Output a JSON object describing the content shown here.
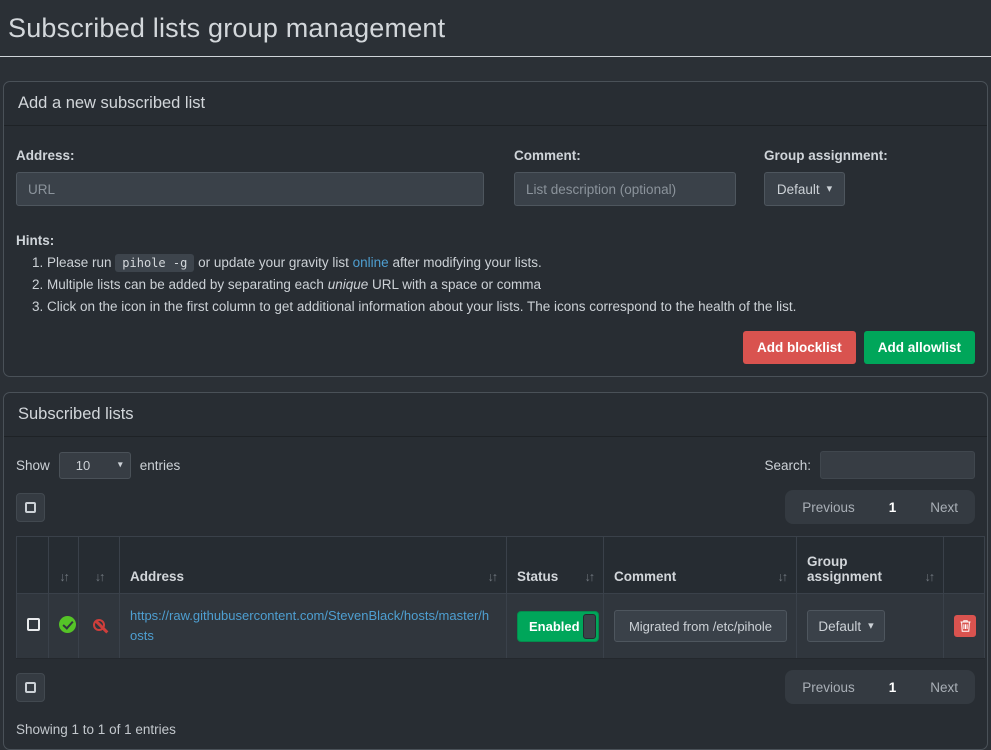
{
  "page_title": "Subscribed lists group management",
  "colors": {
    "accent_red": "#d9534f",
    "accent_green": "#00a65a",
    "link_blue": "#4e9fd1",
    "health_ok_green": "#55c327",
    "health_ban_red": "#ce3e3b"
  },
  "icons": {
    "sort": "↓↑",
    "caret_down": "▾"
  },
  "add_panel": {
    "title": "Add a new subscribed list",
    "address_label": "Address:",
    "address_placeholder": "URL",
    "comment_label": "Comment:",
    "comment_placeholder": "List description (optional)",
    "group_label": "Group assignment:",
    "group_value": "Default",
    "hints_title": "Hints:",
    "hint1": {
      "before_code": "Please run ",
      "code": "pihole -g",
      "after_code": " or update your gravity list ",
      "link_text": "online",
      "after_link": " after modifying your lists."
    },
    "hint2": {
      "before_em": "Multiple lists can be added by separating each ",
      "em_text": "unique",
      "after_em": " URL with a space or comma"
    },
    "hint3": {
      "text": "Click on the icon in the first column to get additional information about your lists. The icons correspond to the health of the list."
    },
    "add_blocklist_label": "Add blocklist",
    "add_allowlist_label": "Add allowlist"
  },
  "lists_panel": {
    "title": "Subscribed lists",
    "show_label": "Show",
    "entries_label": "entries",
    "page_length": "10",
    "search_label": "Search:",
    "search_value": "",
    "pagination": {
      "previous": "Previous",
      "page": "1",
      "next": "Next"
    },
    "table": {
      "headers": {
        "address": "Address",
        "status": "Status",
        "comment": "Comment",
        "group": "Group assignment"
      },
      "row": {
        "address": "https://raw.githubusercontent.com/StevenBlack/hosts/master/hosts",
        "status": "Enabled",
        "comment": "Migrated from /etc/pihole",
        "group": "Default"
      }
    },
    "summary": "Showing 1 to 1 of 1 entries"
  }
}
